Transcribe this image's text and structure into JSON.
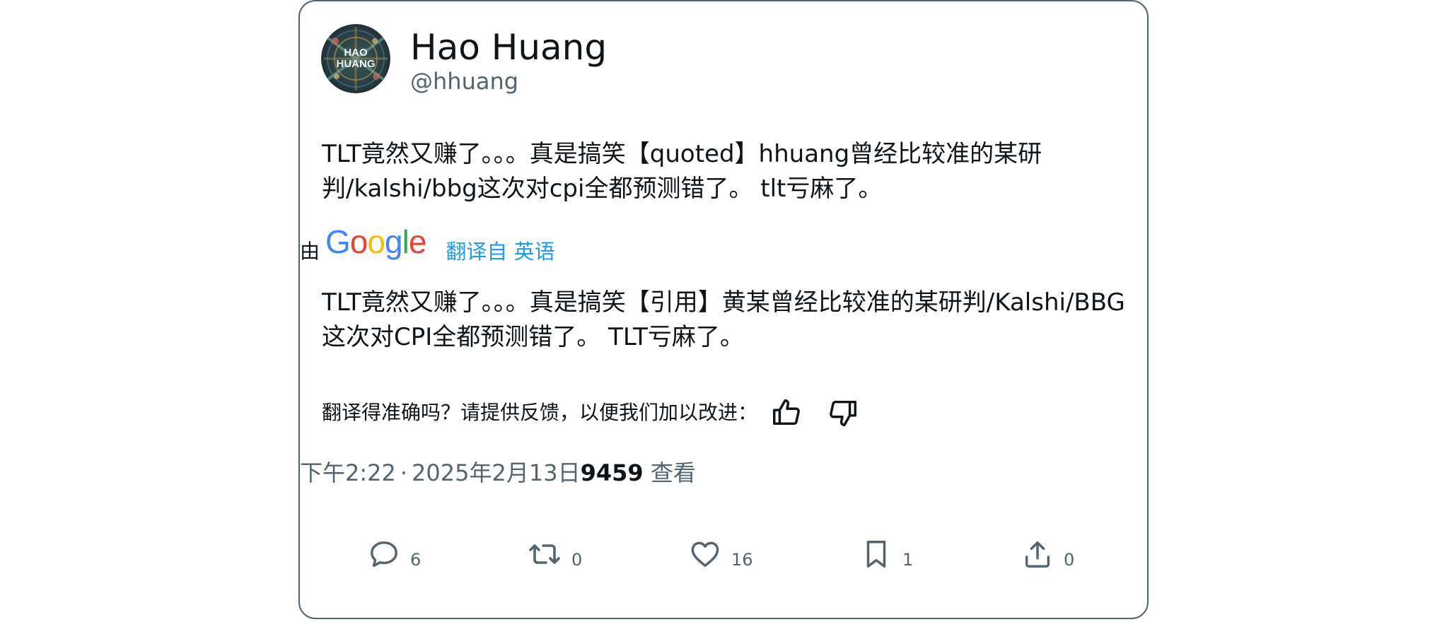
{
  "author": {
    "name": "Hao Huang",
    "handle": "@hhuang",
    "avatar_text": "HAO HUANG"
  },
  "tweet": {
    "original_text": "TLT竟然又赚了。。。真是搞笑【quoted】hhuang曾经比较准的某研判/kalshi/bbg这次对cpi全都预测错了。 tlt亏麻了。",
    "translated_by_label": "由",
    "translator_brand": "Google",
    "translate_link": "翻译自 英语",
    "translated_text": "TLT竟然又赚了。。。真是搞笑【引用】黄某曾经比较准的某研判/Kalshi/BBG这次对CPI全都预测错了。 TLT亏麻了。",
    "feedback_question": "翻译得准确吗？请提供反馈，以便我们加以改进："
  },
  "meta": {
    "time": "下午2:22",
    "separator": "·",
    "date": "2025年2月13日",
    "views_count": "9459",
    "views_label": " 查看"
  },
  "actions": {
    "replies": "6",
    "retweets": "0",
    "likes": "16",
    "bookmarks": "1",
    "shares": "0"
  },
  "icons": {
    "reply": "speech-bubble-icon",
    "retweet": "retweet-icon",
    "like": "heart-icon",
    "bookmark": "bookmark-icon",
    "share": "share-upload-icon",
    "thumbs_up": "thumbs-up-icon",
    "thumbs_down": "thumbs-down-icon"
  },
  "colors": {
    "text": "#0f1419",
    "secondary": "#536471",
    "link": "#1d9bf0",
    "border": "#536471"
  }
}
